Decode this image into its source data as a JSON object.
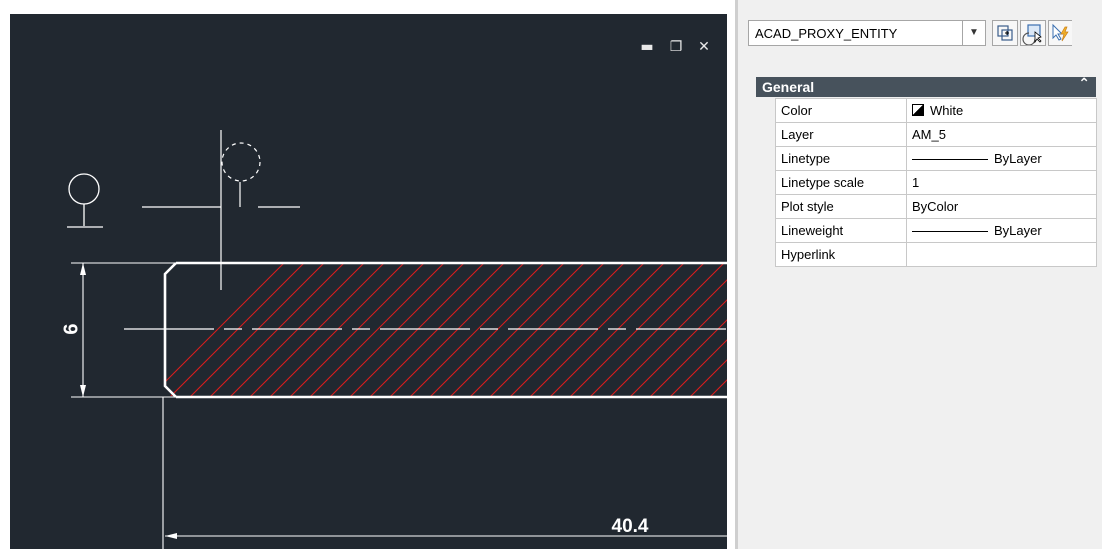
{
  "viewport": {
    "window_controls": {
      "minimize": "▬",
      "restore": "❐",
      "close": "✕"
    },
    "dimension_vertical": "6",
    "dimension_horizontal": "40.4",
    "colors": {
      "background": "#212830",
      "geometry": "#ffffff",
      "hatch": "#d81e1e"
    }
  },
  "properties": {
    "entity_type": "ACAD_PROXY_ENTITY",
    "toolbar_icons": [
      "toggle-pickadd-icon",
      "select-objects-icon",
      "quick-select-icon"
    ],
    "section_title": "General",
    "rows": [
      {
        "name": "Color",
        "value": "White",
        "swatch": true
      },
      {
        "name": "Layer",
        "value": "AM_5"
      },
      {
        "name": "Linetype",
        "value": "ByLayer",
        "line": true
      },
      {
        "name": "Linetype scale",
        "value": "1"
      },
      {
        "name": "Plot style",
        "value": "ByColor"
      },
      {
        "name": "Lineweight",
        "value": "ByLayer",
        "line": true
      },
      {
        "name": "Hyperlink",
        "value": ""
      }
    ]
  }
}
